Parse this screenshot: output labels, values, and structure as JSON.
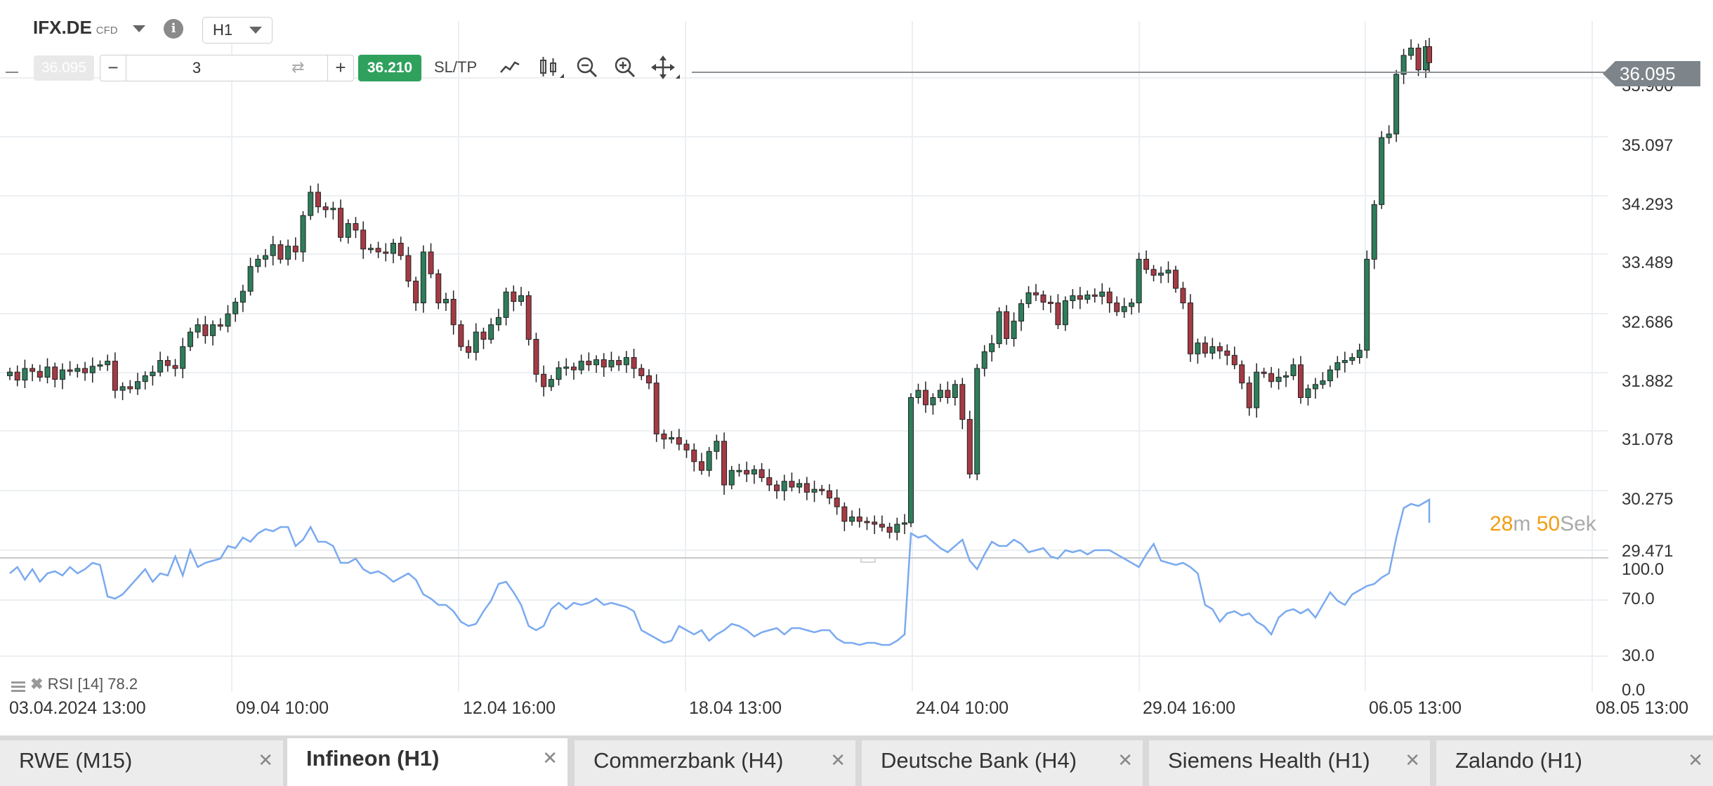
{
  "toolbar": {
    "symbol": "IFX.DE",
    "cfd": "CFD",
    "timeframe": "H1",
    "sell_price": "36.095",
    "quantity": "3",
    "minus": "−",
    "plus": "+",
    "buy_price": "36.210",
    "sltp": "SL/TP",
    "icons": [
      "line-chart-icon",
      "candlestick-icon",
      "zoom-out-icon",
      "zoom-in-icon",
      "move-icon"
    ]
  },
  "price_axis": [
    "35.900",
    "35.097",
    "34.293",
    "33.489",
    "32.686",
    "31.882",
    "31.078",
    "30.275",
    "29.471"
  ],
  "current_price": "36.095",
  "countdown": {
    "m_value": "28",
    "m_unit": "m",
    "s_value": "50",
    "s_unit": "Sek"
  },
  "rsi_axis": [
    "100.0",
    "70.0",
    "30.0",
    "0.0"
  ],
  "rsi_label": "RSI [14] 78.2",
  "x_axis": [
    "03.04.2024 13:00",
    "09.04 10:00",
    "12.04 16:00",
    "18.04 13:00",
    "24.04 10:00",
    "29.04 16:00",
    "06.05 13:00",
    "08.05 13:00"
  ],
  "tabs": [
    {
      "label": "RWE (M15)",
      "active": false
    },
    {
      "label": "Infineon (H1)",
      "active": true
    },
    {
      "label": "Commerzbank (H4)",
      "active": false
    },
    {
      "label": "Deutsche Bank (H4)",
      "active": false
    },
    {
      "label": "Siemens Health (H1)",
      "active": false
    },
    {
      "label": "Zalando (H1)",
      "active": false
    }
  ],
  "colors": {
    "up": "#2e7d5b",
    "down": "#a53a44",
    "rsi": "#7aaaf0",
    "buy": "#2fa15d"
  },
  "chart_data": {
    "type": "candlestick",
    "y_range": [
      29.3,
      36.4
    ],
    "rsi_range": [
      0,
      100
    ],
    "closes": [
      31.85,
      31.74,
      31.9,
      31.86,
      31.78,
      31.92,
      31.75,
      31.88,
      31.86,
      31.9,
      31.84,
      31.93,
      31.95,
      32.0,
      31.6,
      31.65,
      31.62,
      31.72,
      31.8,
      31.85,
      32.01,
      31.94,
      31.9,
      32.2,
      32.4,
      32.5,
      32.35,
      32.5,
      32.48,
      32.65,
      32.81,
      32.96,
      33.3,
      33.4,
      33.45,
      33.6,
      33.4,
      33.58,
      33.5,
      34.0,
      34.32,
      34.12,
      34.08,
      34.1,
      33.7,
      33.89,
      33.8,
      33.54,
      33.55,
      33.5,
      33.48,
      33.62,
      33.45,
      33.1,
      32.8,
      33.5,
      33.2,
      32.8,
      32.85,
      32.5,
      32.2,
      32.12,
      32.4,
      32.3,
      32.5,
      32.6,
      32.95,
      32.82,
      32.9,
      32.3,
      31.82,
      31.65,
      31.75,
      31.91,
      31.92,
      31.88,
      32.0,
      31.95,
      32.02,
      31.92,
      32.01,
      31.95,
      32.05,
      31.9,
      31.8,
      31.7,
      31.0,
      30.93,
      30.95,
      30.86,
      30.78,
      30.62,
      30.5,
      30.76,
      30.9,
      30.3,
      30.5,
      30.5,
      30.45,
      30.51,
      30.4,
      30.3,
      30.22,
      30.35,
      30.27,
      30.32,
      30.2,
      30.24,
      30.22,
      30.12,
      30.0,
      29.8,
      29.86,
      29.8,
      29.79,
      29.76,
      29.72,
      29.65,
      29.76,
      29.78,
      31.5,
      31.6,
      31.4,
      31.5,
      31.6,
      31.5,
      31.68,
      31.2,
      30.45,
      31.9,
      32.13,
      32.24,
      32.68,
      32.31,
      32.55,
      32.79,
      32.94,
      32.91,
      32.81,
      32.8,
      32.5,
      32.83,
      32.9,
      32.85,
      32.91,
      32.89,
      32.95,
      32.8,
      32.68,
      32.75,
      32.8,
      33.4,
      33.26,
      33.18,
      33.21,
      33.25,
      33.0,
      32.8,
      32.1,
      32.25,
      32.11,
      32.2,
      32.14,
      32.08,
      31.95,
      31.7,
      31.36,
      31.85,
      31.83,
      31.72,
      31.78,
      31.8,
      31.95,
      31.5,
      31.62,
      31.68,
      31.73,
      31.88,
      31.98,
      32.01,
      32.05,
      32.15,
      33.4,
      34.15,
      35.07,
      35.12,
      35.94,
      36.2,
      36.3,
      36.0,
      36.32,
      36.1
    ],
    "rsi": [
      55,
      58,
      52,
      57,
      51,
      55,
      56,
      54,
      58,
      55,
      57,
      60,
      59,
      44,
      43,
      45,
      49,
      53,
      57,
      51,
      55,
      54,
      63,
      54,
      66,
      58,
      60,
      61,
      62,
      68,
      67,
      72,
      70,
      74,
      76,
      75,
      77,
      77,
      68,
      71,
      77,
      70,
      70,
      68,
      60,
      60,
      62,
      57,
      55,
      56,
      54,
      51,
      53,
      55,
      52,
      45,
      43,
      40,
      40,
      37,
      32,
      30,
      31,
      37,
      42,
      50,
      51,
      46,
      40,
      30,
      28,
      30,
      38,
      41,
      38,
      41,
      40,
      41,
      43,
      40,
      41,
      40,
      39,
      37,
      28,
      26,
      24,
      22,
      23,
      30,
      28,
      26,
      28,
      23,
      26,
      28,
      31,
      30,
      28,
      25,
      27,
      28,
      29,
      26,
      29,
      29,
      28,
      27,
      28,
      28,
      24,
      22,
      22,
      21,
      22,
      22,
      21,
      21,
      23,
      26,
      74,
      72,
      73,
      70,
      67,
      65,
      68,
      71,
      61,
      57,
      64,
      70,
      68,
      68,
      71,
      69,
      65,
      66,
      67,
      63,
      62,
      66,
      65,
      66,
      64,
      66,
      66,
      66,
      64,
      62,
      60,
      58,
      64,
      69,
      61,
      60,
      59,
      60,
      58,
      55,
      40,
      38,
      32,
      36,
      37,
      35,
      36,
      32,
      30,
      26,
      34,
      37,
      38,
      36,
      38,
      34,
      40,
      46,
      42,
      40,
      45,
      47,
      49,
      50,
      53,
      55,
      72,
      86,
      88,
      87,
      89,
      90,
      87,
      84,
      82,
      79
    ]
  }
}
